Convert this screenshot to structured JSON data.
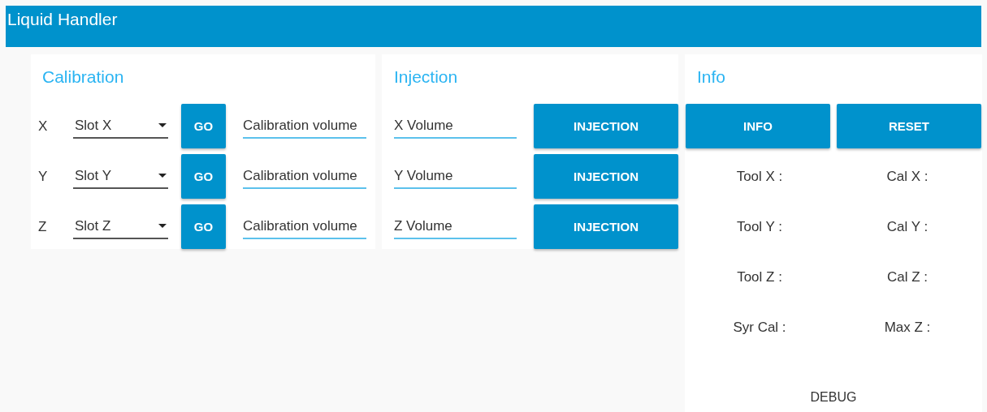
{
  "window": {
    "title": "Liquid Handler"
  },
  "calibration": {
    "title": "Calibration",
    "rows": [
      {
        "axis": "X",
        "slot": "Slot X",
        "button": "GO",
        "placeholder": "Calibration volume"
      },
      {
        "axis": "Y",
        "slot": "Slot Y",
        "button": "GO",
        "placeholder": "Calibration volume"
      },
      {
        "axis": "Z",
        "slot": "Slot Z",
        "button": "GO",
        "placeholder": "Calibration volume"
      }
    ]
  },
  "injection": {
    "title": "Injection",
    "rows": [
      {
        "placeholder": "X Volume",
        "button": "INJECTION"
      },
      {
        "placeholder": "Y Volume",
        "button": "INJECTION"
      },
      {
        "placeholder": "Z Volume",
        "button": "INJECTION"
      }
    ]
  },
  "info": {
    "title": "Info",
    "buttons": [
      "INFO",
      "RESET"
    ],
    "labels": [
      "Tool X :",
      "Cal X :",
      "Tool Y :",
      "Cal Y :",
      "Tool Z :",
      "Cal Z :",
      "Syr Cal :",
      "Max Z :"
    ],
    "debug": "DEBUG"
  }
}
